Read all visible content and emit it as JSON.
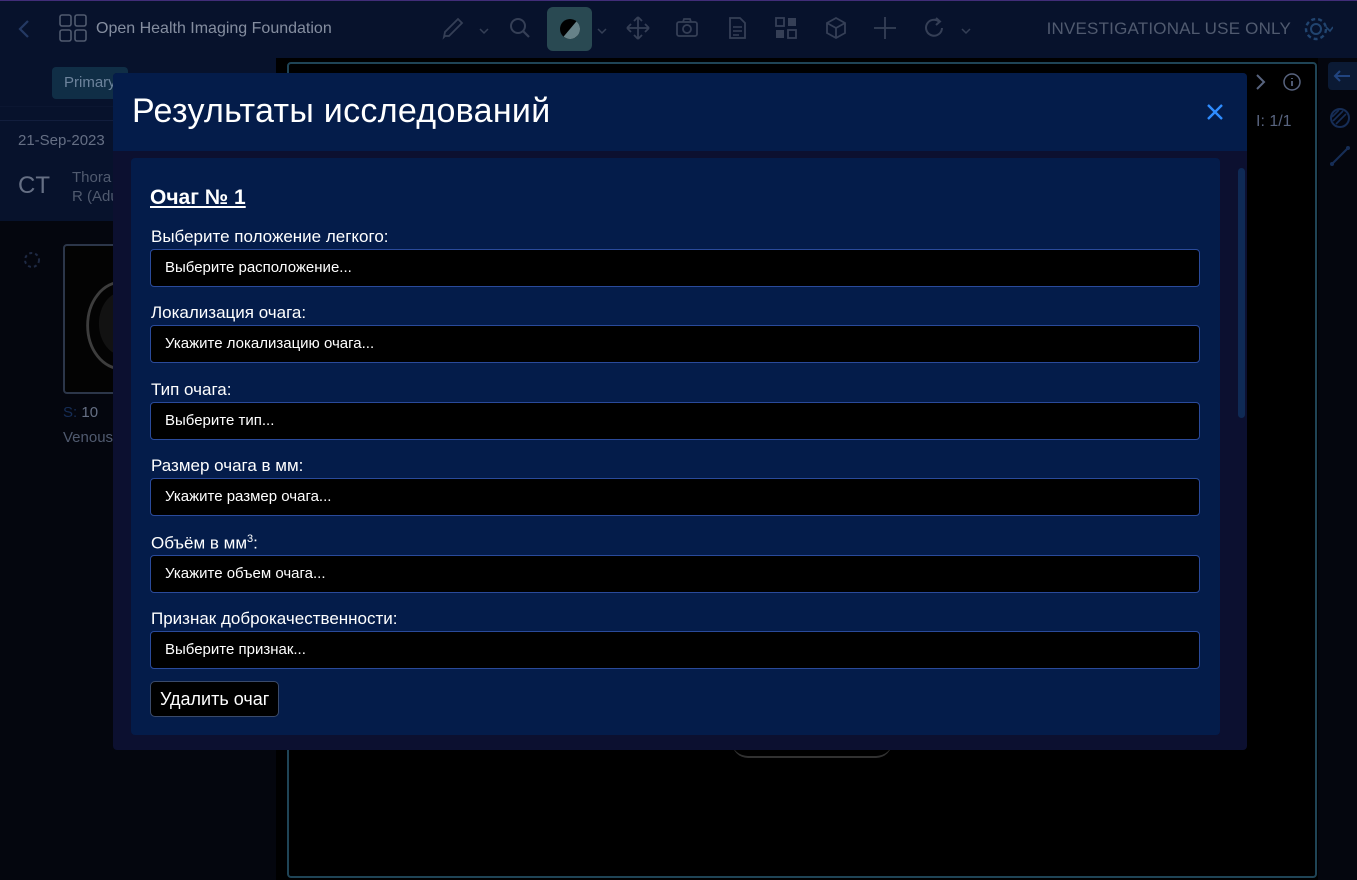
{
  "app": {
    "name": "Open Health Imaging Foundation",
    "disclaimer": "INVESTIGATIONAL USE ONLY"
  },
  "left_panel": {
    "primary_tab": "Primary",
    "study": {
      "date": "21-Sep-2023",
      "modality": "CT",
      "description_line1": "Thora",
      "description_line2": "R (Adu"
    },
    "series": {
      "label_prefix": "S:",
      "number": "10",
      "description": "Venous"
    }
  },
  "viewport": {
    "index": "I: 1/1"
  },
  "modal": {
    "title": "Результаты исследований",
    "lesion_title": "Очаг № 1",
    "fields": [
      {
        "label": "Выберите положение легкого:",
        "value": "Выберите расположение..."
      },
      {
        "label": "Локализация очага:",
        "value": "Укажите локализацию очага..."
      },
      {
        "label": "Тип очага:",
        "value": "Выберите тип..."
      },
      {
        "label": "Размер очага в мм:",
        "value": "Укажите размер очага..."
      },
      {
        "label": "Объём в мм",
        "label_sup": "3",
        "label_suffix": ":",
        "value": "Укажите объем очага..."
      },
      {
        "label": "Признак доброкачественности:",
        "value": "Выберите признак..."
      }
    ],
    "delete_button": "Удалить очаг"
  },
  "colors": {
    "modal_header": "#041c4a",
    "field_border": "#2a4a9a",
    "close_icon": "#2f8cff",
    "active_tool": "#3a6672"
  }
}
